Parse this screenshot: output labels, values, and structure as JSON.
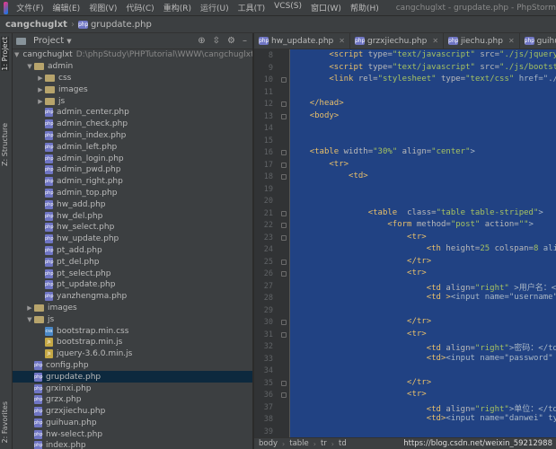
{
  "menu": {
    "items": [
      "文件(F)",
      "编辑(E)",
      "视图(V)",
      "代码(C)",
      "重构(R)",
      "运行(U)",
      "工具(T)",
      "VCS(S)",
      "窗口(W)",
      "帮助(H)"
    ],
    "window_title": "cangchuglxt - grupdate.php - PhpStorm"
  },
  "navbar": {
    "project": "cangchuglxt",
    "file": "grupdate.php"
  },
  "leftstrip": {
    "project_tab": "1: Project",
    "structure_tab": "Z: Structure",
    "favorites_tab": "2: Favorites"
  },
  "project_panel": {
    "title": "Project",
    "root_name": "cangchuglxt",
    "root_path": "D:\\phpStudy\\PHPTutorial\\WWW\\cangchuglxt",
    "admin": "admin",
    "admin_folders": [
      "css",
      "images",
      "js"
    ],
    "admin_files": [
      "admin_center.php",
      "admin_check.php",
      "admin_index.php",
      "admin_left.php",
      "admin_login.php",
      "admin_pwd.php",
      "admin_right.php",
      "admin_top.php",
      "hw_add.php",
      "hw_del.php",
      "hw_select.php",
      "hw_update.php",
      "pt_add.php",
      "pt_del.php",
      "pt_select.php",
      "pt_update.php",
      "yanzhengma.php"
    ],
    "images": "images",
    "js": "js",
    "js_files": [
      "bootstrap.min.css",
      "bootstrap.min.js",
      "jquery-3.6.0.min.js"
    ],
    "root_files": [
      "config.php",
      "grupdate.php",
      "grxinxi.php",
      "grzx.php",
      "grzxjiechu.php",
      "guihuan.php",
      "hw-select.php",
      "index.php"
    ]
  },
  "tabs": [
    "hw_update.php",
    "grzxjiechu.php",
    "jiechu.php",
    "guihuan.php"
  ],
  "editor": {
    "line_numbers": [
      "8",
      "9",
      "10",
      "11",
      "12",
      "13",
      "14",
      "15",
      "16",
      "17",
      "18",
      "19",
      "20",
      "21",
      "22",
      "23",
      "24",
      "25",
      "26",
      "27",
      "28",
      "29",
      "30",
      "31",
      "32",
      "33",
      "34",
      "35",
      "36",
      "37",
      "38",
      "39"
    ],
    "lines": [
      {
        "indent": "        ",
        "tag": "<script ",
        "attr": "type=",
        "str": "\"text/javascript\"",
        "attr2": " src=",
        "str2": "\"./js/jquery-3.",
        "rest": ""
      },
      {
        "indent": "        ",
        "tag": "<script ",
        "attr": "type=",
        "str": "\"text/javascript\"",
        "attr2": " src=",
        "str2": "\"./js/bootstrap",
        "rest": ""
      },
      {
        "indent": "        ",
        "tag": "<link ",
        "attr": "rel=",
        "str": "\"stylesheet\"",
        "attr2": " type=",
        "str2": "\"text/css\"",
        "rest": " href=\"./js/"
      },
      {
        "indent": "",
        "tag": "",
        "attr": "",
        "str": "",
        "attr2": "",
        "str2": "",
        "rest": ""
      },
      {
        "indent": "    ",
        "tag": "</head>",
        "attr": "",
        "str": "",
        "attr2": "",
        "str2": "",
        "rest": ""
      },
      {
        "indent": "    ",
        "tag": "<body>",
        "attr": "",
        "str": "",
        "attr2": "",
        "str2": "",
        "rest": ""
      },
      {
        "indent": "",
        "tag": "",
        "attr": "",
        "str": "",
        "attr2": "",
        "str2": "",
        "rest": ""
      },
      {
        "indent": "",
        "tag": "",
        "attr": "",
        "str": "",
        "attr2": "",
        "str2": "",
        "rest": ""
      },
      {
        "indent": "    ",
        "tag": "<table ",
        "attr": "width=",
        "str": "\"30%\"",
        "attr2": " align=",
        "str2": "\"center\"",
        "rest": ">"
      },
      {
        "indent": "        ",
        "tag": "<tr>",
        "attr": "",
        "str": "",
        "attr2": "",
        "str2": "",
        "rest": ""
      },
      {
        "indent": "            ",
        "tag": "<td>",
        "attr": "",
        "str": "",
        "attr2": "",
        "str2": "",
        "rest": ""
      },
      {
        "indent": "",
        "tag": "",
        "attr": "",
        "str": "",
        "attr2": "",
        "str2": "",
        "rest": ""
      },
      {
        "indent": "",
        "tag": "",
        "attr": "",
        "str": "",
        "attr2": "",
        "str2": "",
        "rest": ""
      },
      {
        "indent": "                ",
        "tag": "<table  ",
        "attr": "class=",
        "str": "\"table table-striped\"",
        "attr2": "",
        "str2": "",
        "rest": ">"
      },
      {
        "indent": "                    ",
        "tag": "<form ",
        "attr": "method=",
        "str": "\"post\"",
        "attr2": " action=",
        "str2": "\"\"",
        "rest": ">"
      },
      {
        "indent": "                        ",
        "tag": "<tr>",
        "attr": "",
        "str": "",
        "attr2": "",
        "str2": "",
        "rest": ""
      },
      {
        "indent": "                            ",
        "tag": "<th ",
        "attr": "height=",
        "str": "25",
        "attr2": " colspan=",
        "str2": "8",
        "rest": " align="
      },
      {
        "indent": "                        ",
        "tag": "</tr>",
        "attr": "",
        "str": "",
        "attr2": "",
        "str2": "",
        "rest": ""
      },
      {
        "indent": "                        ",
        "tag": "<tr>",
        "attr": "",
        "str": "",
        "attr2": "",
        "str2": "",
        "rest": ""
      },
      {
        "indent": "                            ",
        "tag": "<td ",
        "attr": "align=",
        "str": "\"right\"",
        "attr2": "",
        "str2": "",
        "rest": " >用户名：</td"
      },
      {
        "indent": "                            ",
        "tag": "<td >",
        "attr": "",
        "str": "",
        "attr2": "",
        "str2": "",
        "rest": "<input name=\"username\" ty"
      },
      {
        "indent": "",
        "tag": "",
        "attr": "",
        "str": "",
        "attr2": "",
        "str2": "",
        "rest": ""
      },
      {
        "indent": "                        ",
        "tag": "</tr>",
        "attr": "",
        "str": "",
        "attr2": "",
        "str2": "",
        "rest": ""
      },
      {
        "indent": "                        ",
        "tag": "<tr>",
        "attr": "",
        "str": "",
        "attr2": "",
        "str2": "",
        "rest": ""
      },
      {
        "indent": "                            ",
        "tag": "<td ",
        "attr": "align=",
        "str": "\"right\"",
        "attr2": "",
        "str2": "",
        "rest": ">密码：</td>"
      },
      {
        "indent": "                            ",
        "tag": "<td>",
        "attr": "",
        "str": "",
        "attr2": "",
        "str2": "",
        "rest": "<input name=\"password\" typ"
      },
      {
        "indent": "",
        "tag": "",
        "attr": "",
        "str": "",
        "attr2": "",
        "str2": "",
        "rest": ""
      },
      {
        "indent": "                        ",
        "tag": "</tr>",
        "attr": "",
        "str": "",
        "attr2": "",
        "str2": "",
        "rest": ""
      },
      {
        "indent": "                        ",
        "tag": "<tr>",
        "attr": "",
        "str": "",
        "attr2": "",
        "str2": "",
        "rest": ""
      },
      {
        "indent": "                            ",
        "tag": "<td ",
        "attr": "align=",
        "str": "\"right\"",
        "attr2": "",
        "str2": "",
        "rest": ">单位：</td>"
      },
      {
        "indent": "                            ",
        "tag": "<td>",
        "attr": "",
        "str": "",
        "attr2": "",
        "str2": "",
        "rest": "<input name=\"danwei\" type="
      },
      {
        "indent": "",
        "tag": "",
        "attr": "",
        "str": "",
        "attr2": "",
        "str2": "",
        "rest": ""
      }
    ],
    "extra_line": "                        </tr>"
  },
  "status": {
    "crumbs": [
      "body",
      "table",
      "tr",
      "td"
    ],
    "watermark": "https://blog.csdn.net/weixin_59212988"
  },
  "colors": {
    "selection": "#214283",
    "tag": "#e8bf6a",
    "string": "#a5c261",
    "background": "#2b2b2b"
  }
}
